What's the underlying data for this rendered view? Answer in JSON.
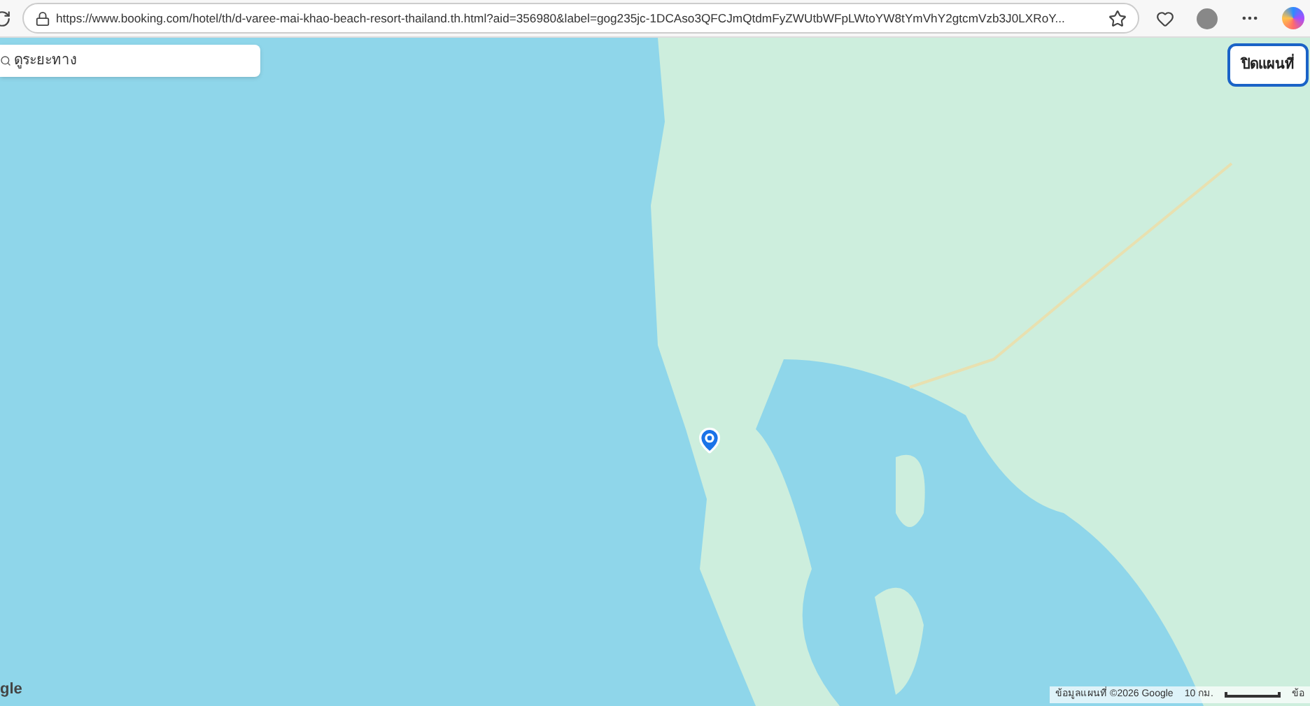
{
  "browser": {
    "url": "https://www.booking.com/hotel/th/d-varee-mai-khao-beach-resort-thailand.th.html?aid=356980&label=gog235jc-1DCAso3QFCJmQtdmFyZWUtbWFpLWtoYW8tYmVhY2gtcmVzb3J0LXRoY..."
  },
  "map": {
    "search": {
      "placeholder": "ดูระยะทาง"
    },
    "close_button": "ปิดแผนที่",
    "logo": "gle",
    "attribution": "ข้อมูลแผนที่ ©2026 Google",
    "scale": "10 กม.",
    "terms": "ข้อ"
  }
}
